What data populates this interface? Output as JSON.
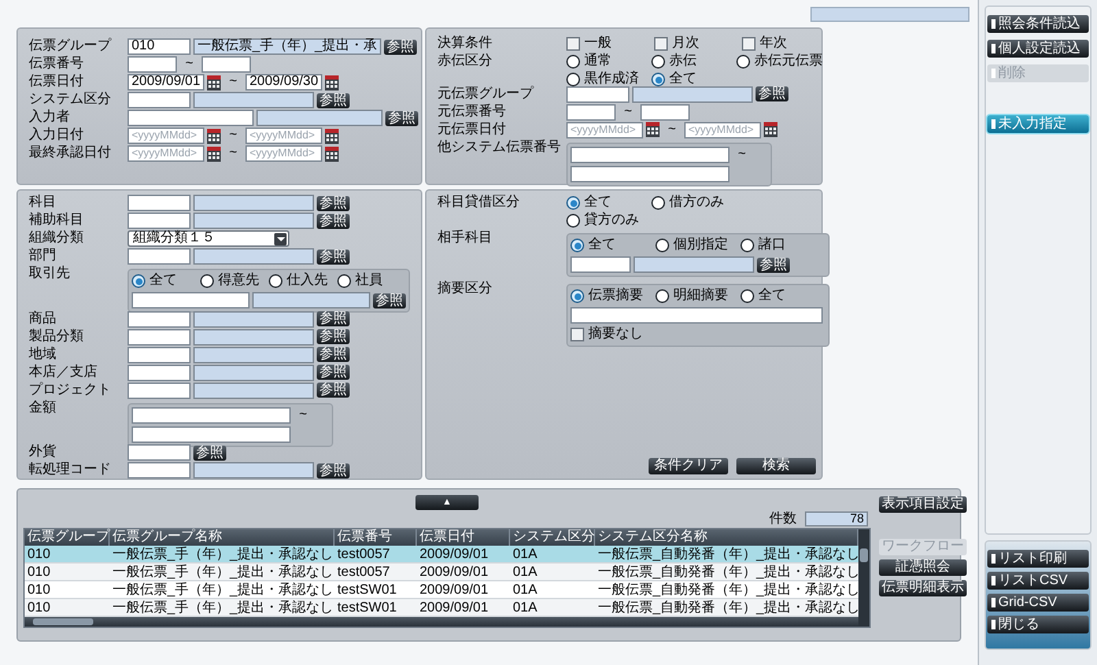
{
  "voucher_panel": [
    {
      "kind": "lookup",
      "label": "伝票グループ",
      "code": "010",
      "name": "一般伝票_手（年）_提出・承",
      "button": "参照"
    },
    {
      "kind": "range",
      "label": "伝票番号",
      "separator": "~"
    },
    {
      "kind": "date_range",
      "label": "伝票日付",
      "from": "2009/09/01",
      "to": "2009/09/30",
      "separator": "~"
    },
    {
      "kind": "lookup",
      "label": "システム区分",
      "button": "参照"
    },
    {
      "kind": "lookup_wide",
      "label": "入力者",
      "button": "参照"
    },
    {
      "kind": "date_range",
      "label": "入力日付",
      "from_placeholder": "<yyyyMMdd>",
      "to_placeholder": "<yyyyMMdd>",
      "separator": "~"
    },
    {
      "kind": "date_range",
      "label": "最終承認日付",
      "from_placeholder": "<yyyyMMdd>",
      "to_placeholder": "<yyyyMMdd>",
      "separator": "~"
    }
  ],
  "condition_panel": [
    {
      "kind": "checks",
      "label": "決算条件",
      "options": [
        {
          "label": "一般",
          "checked": false
        },
        {
          "label": "月次",
          "checked": false
        },
        {
          "label": "年次",
          "checked": false
        }
      ]
    },
    {
      "kind": "radios",
      "label": "赤伝区分",
      "options": [
        {
          "label": "通常",
          "selected": false
        },
        {
          "label": "赤伝",
          "selected": false
        },
        {
          "label": "赤伝元伝票",
          "selected": false
        },
        {
          "label": "黒作成済",
          "selected": false
        },
        {
          "label": "全て",
          "selected": true
        }
      ]
    },
    {
      "kind": "lookup",
      "label": "元伝票グループ",
      "button": "参照"
    },
    {
      "kind": "range",
      "label": "元伝票番号",
      "separator": "~"
    },
    {
      "kind": "date_range",
      "label": "元伝票日付",
      "from_placeholder": "<yyyyMMdd>",
      "to_placeholder": "<yyyyMMdd>",
      "separator": "~"
    },
    {
      "kind": "range_box",
      "label": "他システム伝票番号",
      "separator": "~"
    }
  ],
  "account_panel": [
    {
      "kind": "lookup",
      "label": "科目",
      "button": "参照"
    },
    {
      "kind": "lookup",
      "label": "補助科目",
      "button": "参照"
    },
    {
      "kind": "select",
      "label": "組織分類",
      "value": "組織分類１５"
    },
    {
      "kind": "lookup",
      "label": "部門",
      "button": "参照"
    },
    {
      "kind": "radio_lookup",
      "label": "取引先",
      "options": [
        {
          "label": "全て",
          "selected": true
        },
        {
          "label": "得意先",
          "selected": false
        },
        {
          "label": "仕入先",
          "selected": false
        },
        {
          "label": "社員",
          "selected": false
        }
      ],
      "button": "参照"
    },
    {
      "kind": "lookup",
      "label": "商品",
      "button": "参照"
    },
    {
      "kind": "lookup",
      "label": "製品分類",
      "button": "参照"
    },
    {
      "kind": "lookup",
      "label": "地域",
      "button": "参照"
    },
    {
      "kind": "lookup",
      "label": "本店／支店",
      "button": "参照"
    },
    {
      "kind": "lookup",
      "label": "プロジェクト",
      "button": "参照"
    },
    {
      "kind": "range_box",
      "label": "金額",
      "separator": "~"
    },
    {
      "kind": "code_button",
      "label": "外貨",
      "button": "参照"
    },
    {
      "kind": "lookup",
      "label": "転処理コード",
      "button": "参照"
    }
  ],
  "debit_panel": [
    {
      "kind": "radios",
      "label": "科目貸借区分",
      "options": [
        {
          "label": "全て",
          "selected": true
        },
        {
          "label": "借方のみ",
          "selected": false
        },
        {
          "label": "貸方のみ",
          "selected": false
        }
      ]
    },
    {
      "kind": "radio_lookup",
      "label": "相手科目",
      "options": [
        {
          "label": "全て",
          "selected": true
        },
        {
          "label": "個別指定",
          "selected": false
        },
        {
          "label": "諸口",
          "selected": false
        }
      ],
      "button": "参照"
    },
    {
      "kind": "radio_text",
      "label": "摘要区分",
      "options": [
        {
          "label": "伝票摘要",
          "selected": true
        },
        {
          "label": "明細摘要",
          "selected": false
        },
        {
          "label": "全て",
          "selected": false
        }
      ],
      "check": {
        "label": "摘要なし",
        "checked": false
      }
    }
  ],
  "form_buttons": [
    "条件クリア",
    "検索"
  ],
  "collapse_button": "▲",
  "count": {
    "label": "件数",
    "value": "78"
  },
  "table": {
    "columns": [
      "伝票グループ",
      "伝票グループ名称",
      "伝票番号",
      "伝票日付",
      "システム区分",
      "システム区分名称"
    ],
    "rows": [
      {
        "cells": [
          "010",
          "一般伝票_手（年）_提出・承認なし",
          "test0057",
          "2009/09/01",
          "01A",
          "一般伝票_自動発番（年）_提出・承認なし"
        ],
        "selected": true
      },
      {
        "cells": [
          "010",
          "一般伝票_手（年）_提出・承認なし",
          "test0057",
          "2009/09/01",
          "01A",
          "一般伝票_自動発番（年）_提出・承認なし"
        ],
        "selected": false
      },
      {
        "cells": [
          "010",
          "一般伝票_手（年）_提出・承認なし",
          "testSW01",
          "2009/09/01",
          "01A",
          "一般伝票_自動発番（年）_提出・承認なし"
        ],
        "selected": false
      },
      {
        "cells": [
          "010",
          "一般伝票_手（年）_提出・承認なし",
          "testSW01",
          "2009/09/01",
          "01A",
          "一般伝票_自動発番（年）_提出・承認なし"
        ],
        "selected": false
      }
    ]
  },
  "table_buttons": [
    {
      "label": "表示項目設定",
      "disabled": false
    },
    {
      "label": "ワークフロー",
      "disabled": true
    },
    {
      "label": "証憑照会",
      "disabled": false
    },
    {
      "label": "伝票明細表示",
      "disabled": false
    }
  ],
  "sidebar_top": [
    {
      "label": "照会条件読込",
      "disabled": false,
      "highlighted": false
    },
    {
      "label": "個人設定読込",
      "disabled": false,
      "highlighted": false
    },
    {
      "label": "削除",
      "disabled": true,
      "highlighted": false
    },
    {
      "label": "未入力指定",
      "disabled": false,
      "highlighted": true
    }
  ],
  "sidebar_bottom": [
    {
      "label": "リスト印刷"
    },
    {
      "label": "リストCSV"
    },
    {
      "label": "Grid-CSV"
    },
    {
      "label": "閉じる"
    }
  ]
}
